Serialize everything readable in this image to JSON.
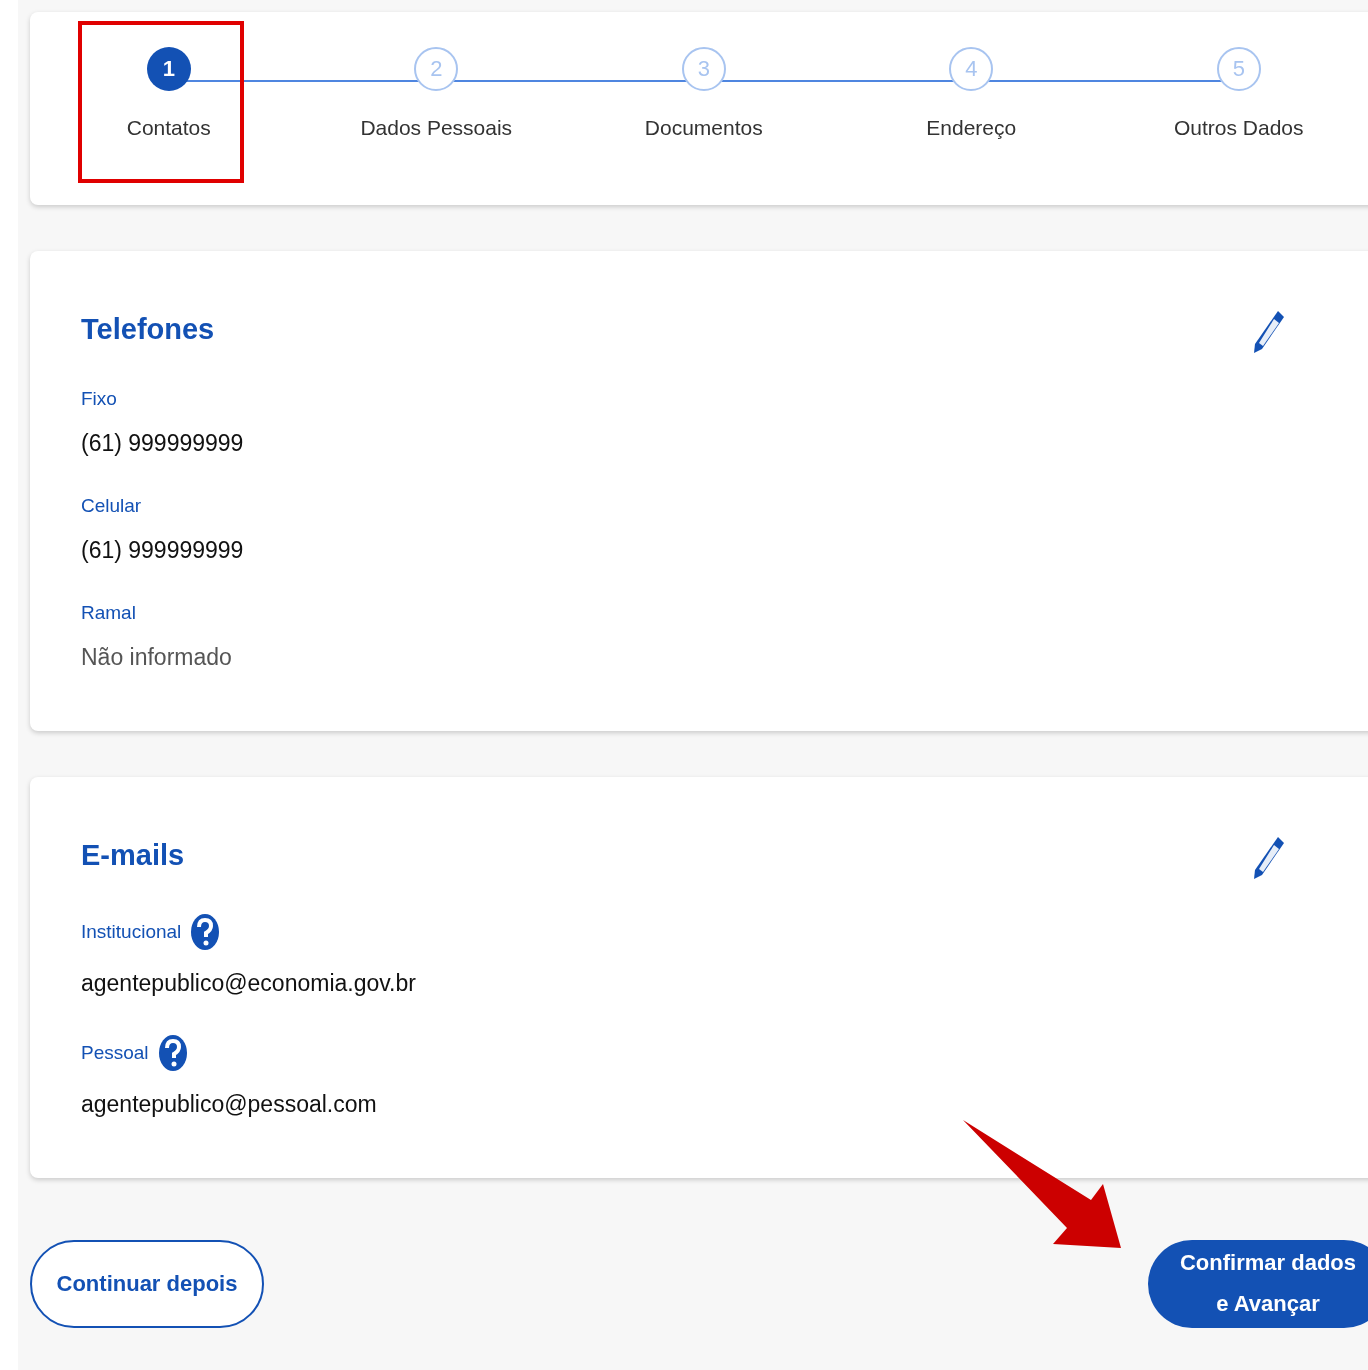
{
  "steps": [
    {
      "number": "1",
      "label": "Contatos",
      "selected": true,
      "highlighted": true
    },
    {
      "number": "2",
      "label": "Dados Pessoais",
      "selected": false,
      "highlighted": false
    },
    {
      "number": "3",
      "label": "Documentos",
      "selected": false,
      "highlighted": false
    },
    {
      "number": "4",
      "label": "Endereço",
      "selected": false,
      "highlighted": false
    },
    {
      "number": "5",
      "label": "Outros Dados",
      "selected": false,
      "highlighted": false
    }
  ],
  "sections": [
    {
      "title": "Telefones",
      "fields": [
        {
          "label": "Fixo",
          "value": "(61) 999999999",
          "help": false,
          "muted": false
        },
        {
          "label": "Celular",
          "value": "(61) 999999999",
          "help": false,
          "muted": false
        },
        {
          "label": "Ramal",
          "value": "Não informado",
          "help": false,
          "muted": true
        }
      ]
    },
    {
      "title": "E-mails",
      "fields": [
        {
          "label": "Institucional",
          "value": "agentepublico@economia.gov.br",
          "help": true,
          "muted": false
        },
        {
          "label": "Pessoal",
          "value": "agentepublico@pessoal.com",
          "help": true,
          "muted": false
        }
      ]
    }
  ],
  "buttons": [
    {
      "kind": "secondary",
      "label": "Continuar depois",
      "annotated": false
    },
    {
      "kind": "primary",
      "label": "Confirmar dados e Avançar",
      "annotated": true
    }
  ]
}
